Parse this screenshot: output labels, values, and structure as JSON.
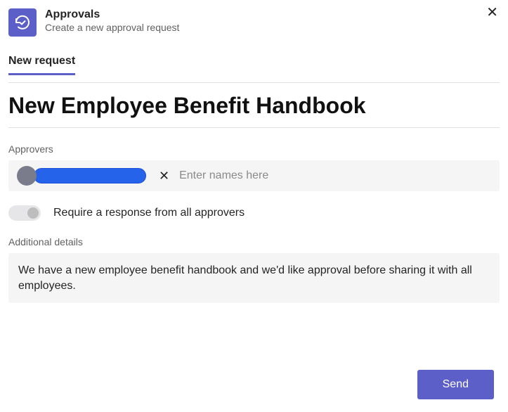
{
  "header": {
    "app_title": "Approvals",
    "app_subtitle": "Create a new approval request"
  },
  "tabs": {
    "new_request": "New request"
  },
  "form": {
    "title": "New Employee Benefit Handbook",
    "approvers_label": "Approvers",
    "approvers_placeholder": "Enter names here",
    "require_all_label": "Require a response from all approvers",
    "details_label": "Additional details",
    "details_value": "We have a new employee benefit handbook and we'd like approval before sharing it with all employees."
  },
  "actions": {
    "send": "Send",
    "close": "✕",
    "remove_chip": "✕"
  }
}
